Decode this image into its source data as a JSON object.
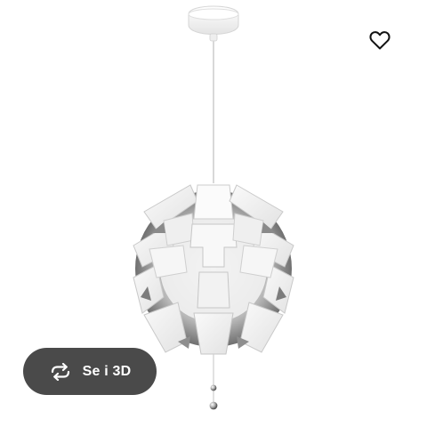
{
  "view_3d_button": {
    "label": "Se i 3D",
    "icon": "rotate-3d-icon"
  },
  "favorite_button": {
    "icon": "heart-icon"
  },
  "product_image": {
    "subject": "pendant-lamp"
  },
  "colors": {
    "button_bg": "#4a4a4a",
    "button_text": "#ffffff",
    "heart_stroke": "#111111",
    "lamp_white": "#f2f2f2",
    "lamp_silver": "#9a9a9a"
  }
}
